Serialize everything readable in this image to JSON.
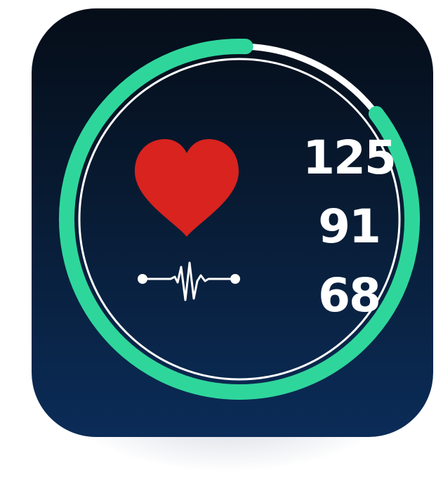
{
  "readings": {
    "systolic": "125",
    "diastolic": "91",
    "pulse": "68"
  },
  "ring": {
    "progress_fraction": 0.86
  },
  "icons": {
    "heart": "heart-icon",
    "pulse_line": "heartbeat-line-icon"
  },
  "colors": {
    "background_top": "#050d18",
    "background_bottom": "#0b2c58",
    "ring_progress": "#2fd69b",
    "ring_track": "#ffffff",
    "heart": "#d8231f",
    "text": "#ffffff"
  }
}
